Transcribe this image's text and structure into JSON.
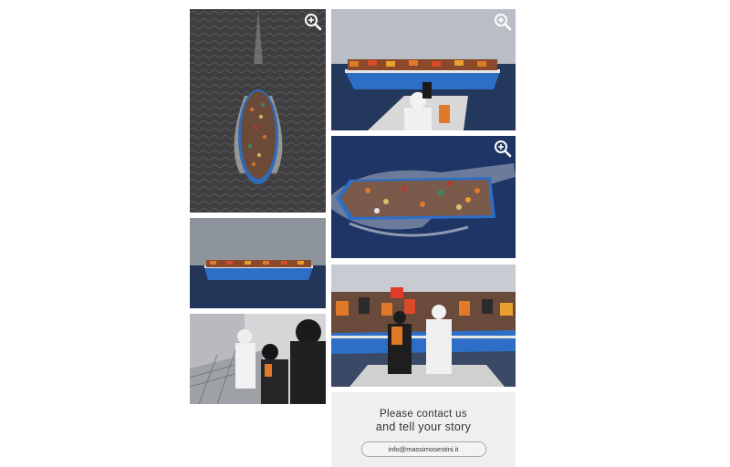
{
  "gallery": {
    "photos": [
      {
        "subject": "aerial-boat-dark-sea",
        "zoomable": true
      },
      {
        "subject": "crowded-blue-boat-with-rescuer",
        "zoomable": true
      },
      {
        "subject": "crowded-boat-aerial-wake",
        "zoomable": true
      },
      {
        "subject": "blue-boat-on-horizon",
        "zoomable": false
      },
      {
        "subject": "rescue-at-ship-rail",
        "zoomable": false
      },
      {
        "subject": "rescuer-helping-people-from-boat",
        "zoomable": false
      }
    ],
    "zoom_icon": "zoom-in-icon"
  },
  "contact": {
    "line1": "Please contact us",
    "line2": "and tell your story",
    "email": "info@massimosestini.it"
  },
  "colors": {
    "panel_bg": "#efefef",
    "text": "#333333",
    "sea_dark": "#1c2f55",
    "boat_blue": "#2d6fc7"
  }
}
